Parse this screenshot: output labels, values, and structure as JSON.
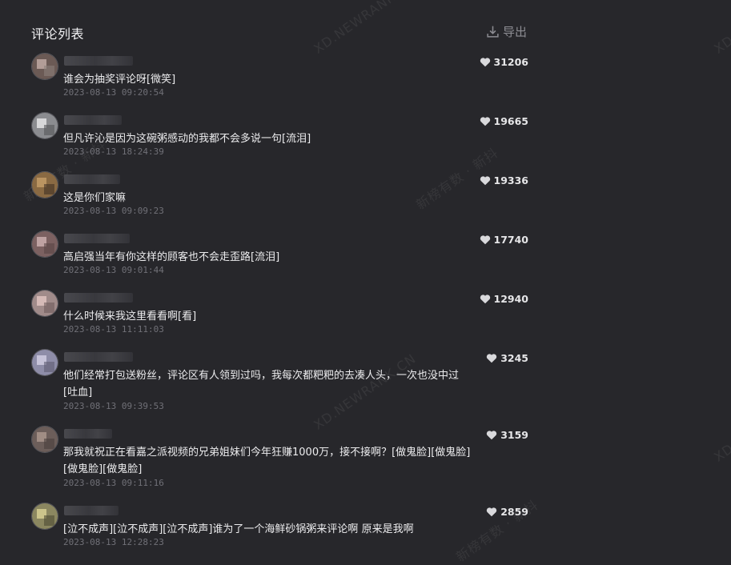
{
  "header": {
    "title": "评论列表",
    "export_label": "导出"
  },
  "watermarks": {
    "en": "XD.NEWRANK.CN",
    "cn": "新榜有数 · 新抖"
  },
  "comments": [
    {
      "text": "谁会为抽奖评论呀[微笑]",
      "date": "2023-08-13 09:20:54",
      "likes": "31206",
      "avatar_colors": [
        "#6b5a55",
        "#c9b4ad",
        "#8a7e7a"
      ]
    },
    {
      "text": "但凡许沁是因为这碗粥感动的我都不会多说一句[流泪]",
      "date": "2023-08-13 18:24:39",
      "likes": "19665",
      "avatar_colors": [
        "#8b8c90",
        "#f0f0f2",
        "#555558"
      ]
    },
    {
      "text": "这是你们家嘛",
      "date": "2023-08-13 09:09:23",
      "likes": "19336",
      "avatar_colors": [
        "#8a6a43",
        "#c9a36b",
        "#3f3024"
      ]
    },
    {
      "text": "高启强当年有你这样的顾客也不会走歪路[流泪]",
      "date": "2023-08-13 09:01:44",
      "likes": "17740",
      "avatar_colors": [
        "#7c6161",
        "#d6b8b8",
        "#5a4545"
      ]
    },
    {
      "text": "什么时候来我这里看看啊[看]",
      "date": "2023-08-13 11:11:03",
      "likes": "12940",
      "avatar_colors": [
        "#a08b8a",
        "#e7c9c6",
        "#6e5c5c"
      ]
    },
    {
      "text": "他们经常打包送粉丝，评论区有人领到过吗，我每次都粑粑的去凑人头，一次也没中过[吐血]",
      "date": "2023-08-13 09:39:53",
      "likes": "3245",
      "avatar_colors": [
        "#8e8da8",
        "#d8d6ea",
        "#5d5c72"
      ]
    },
    {
      "text": "那我就祝正在看嘉之派视频的兄弟姐妹们今年狂赚1000万，接不接啊？[做鬼脸][做鬼脸][做鬼脸][做鬼脸]",
      "date": "2023-08-13 09:11:16",
      "likes": "3159",
      "avatar_colors": [
        "#6c5e5a",
        "#b29d93",
        "#4a3f3c"
      ]
    },
    {
      "text": "[泣不成声][泣不成声][泣不成声]谁为了一个海鲜砂锅粥来评论啊 原来是我啊",
      "date": "2023-08-13 12:28:23",
      "likes": "2859",
      "avatar_colors": [
        "#8b8760",
        "#e0d89a",
        "#4d4a33"
      ]
    }
  ]
}
